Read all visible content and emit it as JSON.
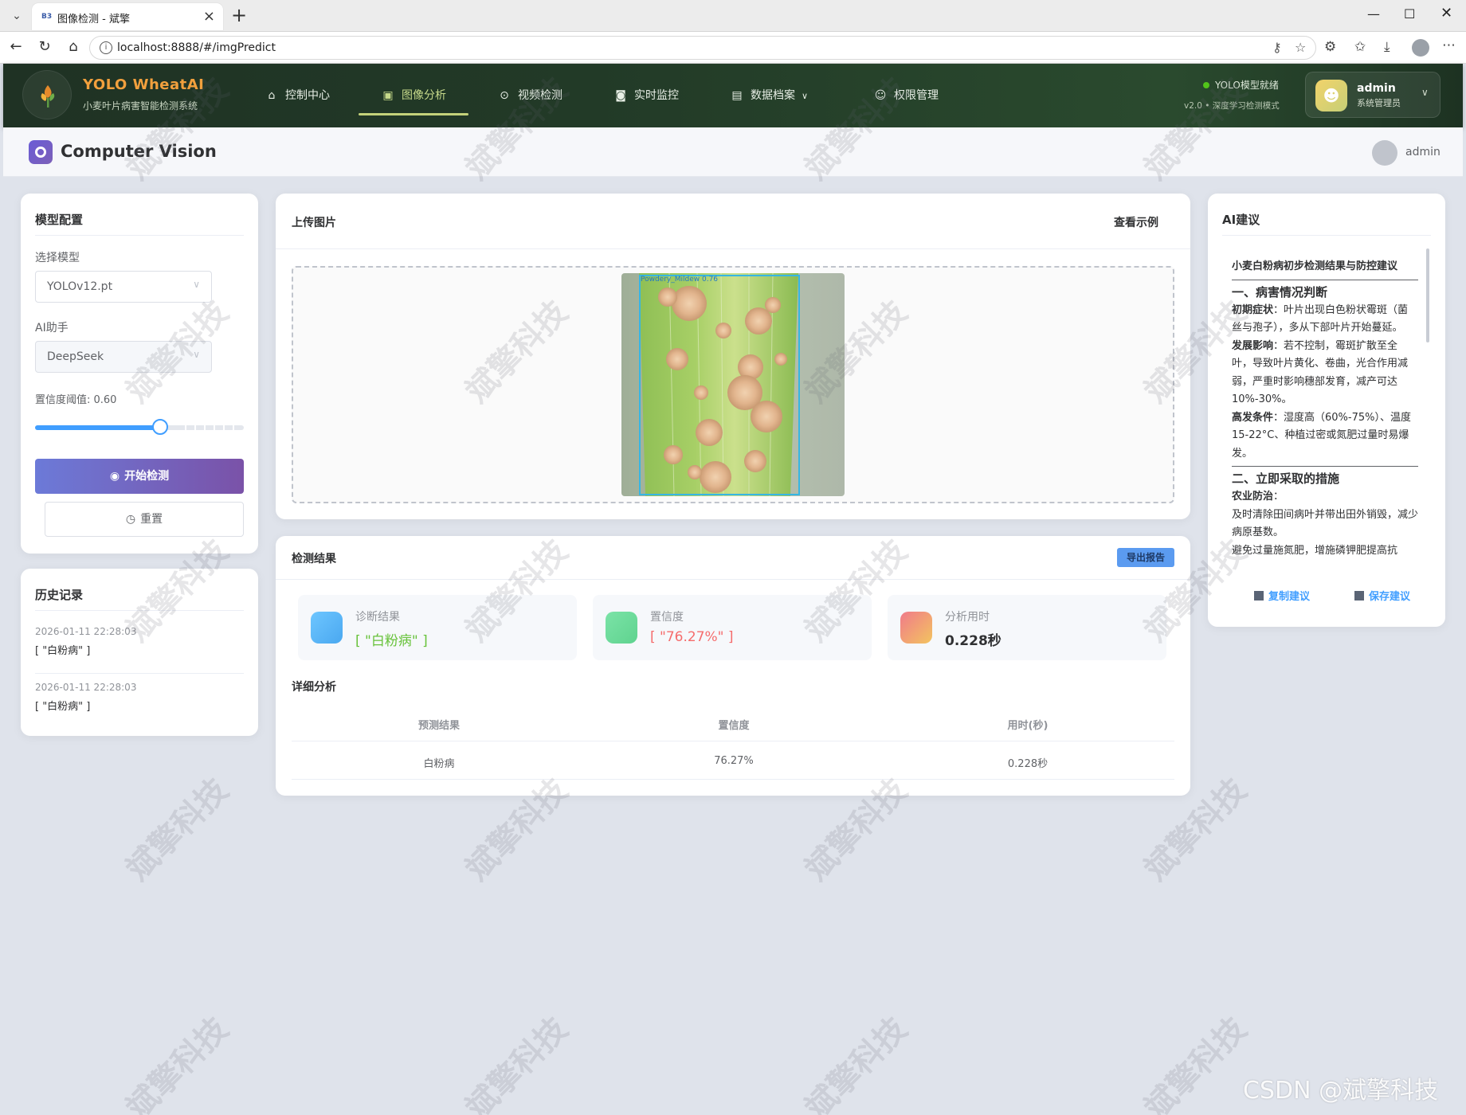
{
  "browser": {
    "tab_title": "图像检测 - 斌擎",
    "favicon_text": "B3",
    "url": "localhost:8888/#/imgPredict"
  },
  "nav": {
    "brand": "YOLO WheatAI",
    "brand_sub": "小麦叶片病害智能检测系统",
    "items": [
      {
        "label": "控制中心",
        "icon": "home-icon"
      },
      {
        "label": "图像分析",
        "icon": "image-icon",
        "active": true
      },
      {
        "label": "视频检测",
        "icon": "play-circle-icon"
      },
      {
        "label": "实时监控",
        "icon": "camera-icon"
      },
      {
        "label": "数据档案",
        "icon": "document-icon",
        "has_dropdown": true
      },
      {
        "label": "权限管理",
        "icon": "user-icon"
      }
    ],
    "status_line1": "YOLO模型就绪",
    "status_line2": "v2.0 • 深度学习检测模式",
    "user_name": "admin",
    "user_role": "系统管理员"
  },
  "header": {
    "title": "Computer Vision",
    "user": "admin"
  },
  "model_config": {
    "title": "模型配置",
    "model_label": "选择模型",
    "model_value": "YOLOv12.pt",
    "ai_label": "AI助手",
    "ai_value": "DeepSeek",
    "threshold_label": "置信度阈值: 0.60",
    "threshold": 0.6,
    "detect_button": "开始检测",
    "reset_button": "重置"
  },
  "history": {
    "title": "历史记录",
    "items": [
      {
        "time": "2026-01-11 22:28:03",
        "result": "[ \"白粉病\" ]"
      },
      {
        "time": "2026-01-11 22:28:03",
        "result": "[ \"白粉病\" ]"
      }
    ]
  },
  "upload": {
    "title": "上传图片",
    "example_link": "查看示例",
    "detection_label": "Powdery_Mildew 0.76"
  },
  "results": {
    "title": "检测结果",
    "export_button": "导出报告",
    "stats": [
      {
        "label": "诊断结果",
        "value": "[ \"白粉病\" ]",
        "color": "#67c23a"
      },
      {
        "label": "置信度",
        "value": "[ \"76.27%\" ]",
        "color": "#f56c6c"
      },
      {
        "label": "分析用时",
        "value": "0.228秒",
        "color": "#303133"
      }
    ],
    "detail_title": "详细分析",
    "columns": [
      "预测结果",
      "置信度",
      "用时(秒)"
    ],
    "rows": [
      [
        "白粉病",
        "76.27%",
        "0.228秒"
      ]
    ]
  },
  "ai": {
    "title": "AI建议",
    "heading": "小麦白粉病初步检测结果与防控建议",
    "section1": "一、病害情况判断",
    "p1_bold": "初期症状",
    "p1": "：叶片出现白色粉状霉斑（菌丝与孢子），多从下部叶片开始蔓延。",
    "p2_bold": "发展影响",
    "p2": "：若不控制，霉斑扩散至全叶，导致叶片黄化、卷曲，光合作用减弱，严重时影响穗部发育，减产可达10%-30%。",
    "p3_bold": "高发条件",
    "p3": "：湿度高（60%-75%）、温度15-22°C、种植过密或氮肥过量时易爆发。",
    "section2": "二、立即采取的措施",
    "p4_bold": "农业防治",
    "p4": "：",
    "p5": "及时清除田间病叶并带出田外销毁，减少病原基数。",
    "p6": "避免过量施氮肥，增施磷钾肥提高抗",
    "copy_button": "复制建议",
    "save_button": "保存建议"
  },
  "watermark": "斌擎科技",
  "footer_mark": "CSDN @斌擎科技"
}
